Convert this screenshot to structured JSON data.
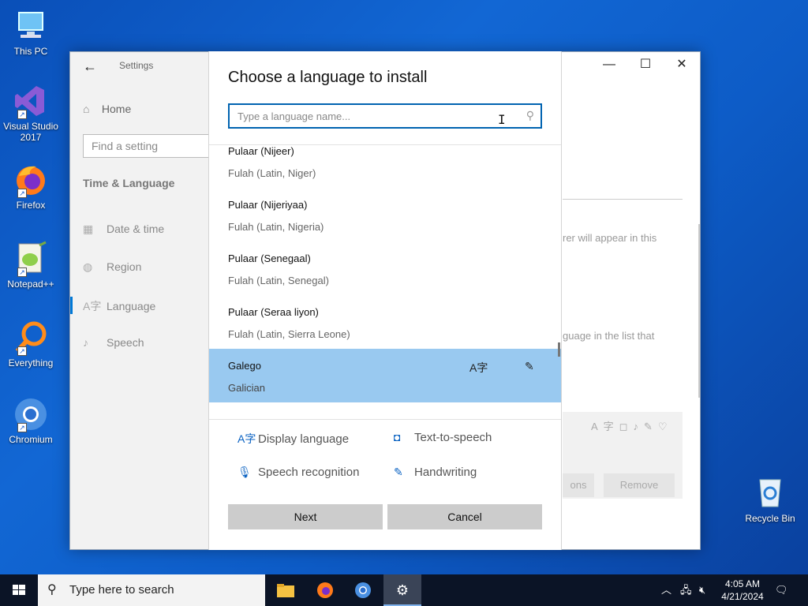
{
  "desktop": {
    "icons": [
      {
        "label": "This PC"
      },
      {
        "label": "Visual Studio 2017"
      },
      {
        "label": "Firefox"
      },
      {
        "label": "Notepad++"
      },
      {
        "label": "Everything"
      },
      {
        "label": "Chromium"
      }
    ],
    "recycle_bin": "Recycle Bin"
  },
  "settings": {
    "title": "Settings",
    "home": "Home",
    "find_placeholder": "Find a setting",
    "section": "Time & Language",
    "nav": [
      {
        "label": "Date & time",
        "icon": "calendar-icon"
      },
      {
        "label": "Region",
        "icon": "globe-icon"
      },
      {
        "label": "Language",
        "icon": "language-icon"
      },
      {
        "label": "Speech",
        "icon": "microphone-icon"
      }
    ],
    "bg_text_1": "rer will appear in this",
    "bg_text_2": "guage in the list that",
    "bg_options": "ons",
    "bg_remove": "Remove"
  },
  "dialog": {
    "title": "Choose a language to install",
    "search_placeholder": "Type a language name...",
    "search_value": "",
    "languages": [
      {
        "native": "Pulaar (Nijeer)",
        "english": "Fulah (Latin, Niger)",
        "selected": false
      },
      {
        "native": "Pulaar (Nijeriyaa)",
        "english": "Fulah (Latin, Nigeria)",
        "selected": false
      },
      {
        "native": "Pulaar (Senegaal)",
        "english": "Fulah (Latin, Senegal)",
        "selected": false
      },
      {
        "native": "Pulaar (Seraa liyon)",
        "english": "Fulah (Latin, Sierra Leone)",
        "selected": false
      },
      {
        "native": "Galego",
        "english": "Galician",
        "selected": true
      }
    ],
    "features": {
      "display_language": "Display language",
      "text_to_speech": "Text-to-speech",
      "speech_recognition": "Speech recognition",
      "handwriting": "Handwriting"
    },
    "next_label": "Next",
    "cancel_label": "Cancel"
  },
  "taskbar": {
    "search_placeholder": "Type here to search",
    "time": "4:05 AM",
    "date": "4/21/2024"
  },
  "colors": {
    "accent": "#0063b1",
    "selected_row": "#99c9f0",
    "taskbar": "#0b1426",
    "desktop": "#0d5cc7"
  }
}
